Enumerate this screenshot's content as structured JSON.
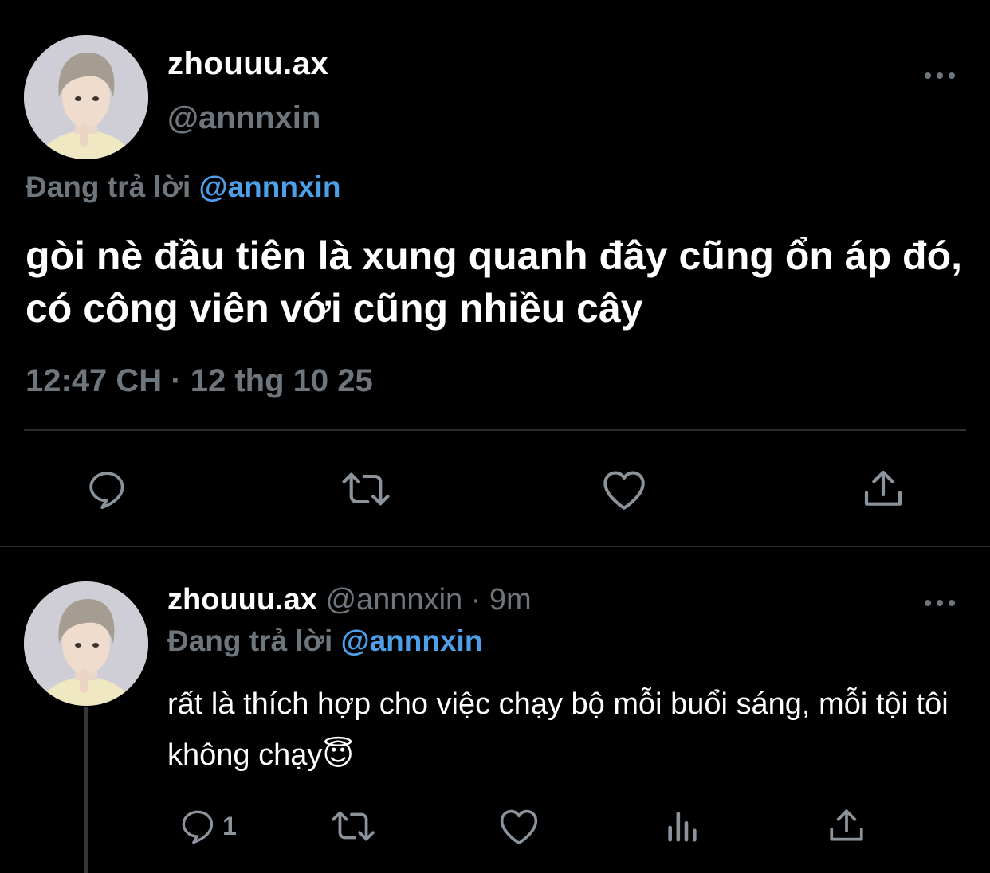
{
  "focused_tweet": {
    "display_name": "zhouuu.ax",
    "handle": "@annnxin",
    "replying_prefix": "Đang trả lời",
    "replying_to": "@annnxin",
    "text": "gòi nè đầu tiên là xung quanh đây cũng ổn áp đó, có công viên với cũng nhiều cây",
    "timestamp": "12:47 CH · 12 thg 10 25",
    "more_icon": "more-horizontal-icon",
    "actions": [
      "reply-icon",
      "retweet-icon",
      "like-icon",
      "share-icon"
    ]
  },
  "reply_tweet": {
    "display_name": "zhouuu.ax",
    "meta": "@annnxin · 9m",
    "replying_prefix": "Đang trả lời",
    "replying_to": "@annnxin",
    "text": "rất là thích hợp cho việc chạy bộ mỗi buổi sáng, mỗi tội tôi không chạy😇",
    "reply_count": "1",
    "more_icon": "more-horizontal-icon",
    "actions": [
      "reply-icon",
      "retweet-icon",
      "like-icon",
      "analytics-icon",
      "share-icon"
    ]
  },
  "colors": {
    "background": "#000000",
    "text_primary": "#ffffff",
    "text_secondary": "#6e767d",
    "link": "#4da0e8",
    "divider": "#2b2f33"
  }
}
